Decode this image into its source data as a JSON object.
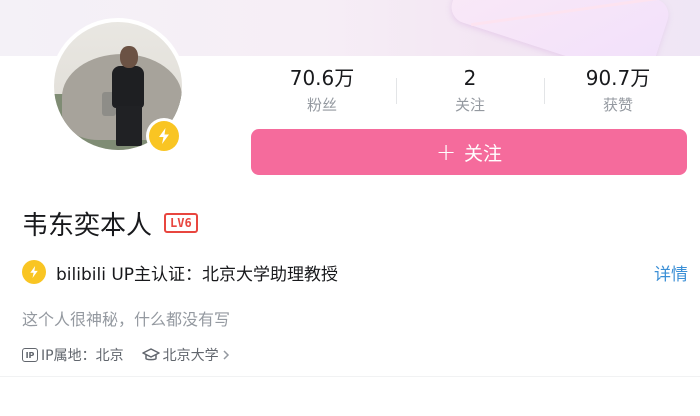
{
  "stats": [
    {
      "value": "70.6万",
      "label": "粉丝"
    },
    {
      "value": "2",
      "label": "关注"
    },
    {
      "value": "90.7万",
      "label": "获赞"
    }
  ],
  "follow_button": {
    "plus": "+",
    "label": "关注"
  },
  "profile": {
    "name": "韦东奕本人",
    "level": "LV6",
    "certification": "bilibili UP主认证：北京大学助理教授",
    "detail_link": "详情",
    "bio": "这个人很神秘，什么都没有写",
    "ip_icon_text": "IP",
    "ip_location": "IP属地：北京",
    "school": "北京大学"
  },
  "colors": {
    "accent_pink": "#f56b9c",
    "verify_yellow": "#f9c523",
    "level_red": "#e8463f",
    "link_blue": "#3b8fd6"
  },
  "icons": [
    "verified-lightning-icon",
    "ip-icon",
    "graduation-cap-icon",
    "chevron-right-icon"
  ]
}
